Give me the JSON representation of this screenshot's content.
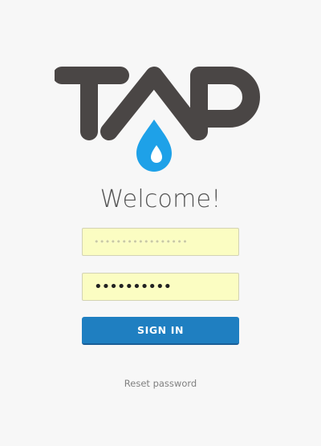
{
  "logo": {
    "text": "TAP",
    "letter_color": "#4a4645",
    "drop_color": "#1ea1e8"
  },
  "welcome": {
    "text": "Welcome!"
  },
  "form": {
    "username_value": "•••••••••••••••••",
    "password_value": "••••••••••",
    "field_background": "#fbfdc2"
  },
  "buttons": {
    "sign_in": "SIGN IN",
    "sign_in_color": "#1f7fc1"
  },
  "links": {
    "reset_password": "Reset password"
  }
}
